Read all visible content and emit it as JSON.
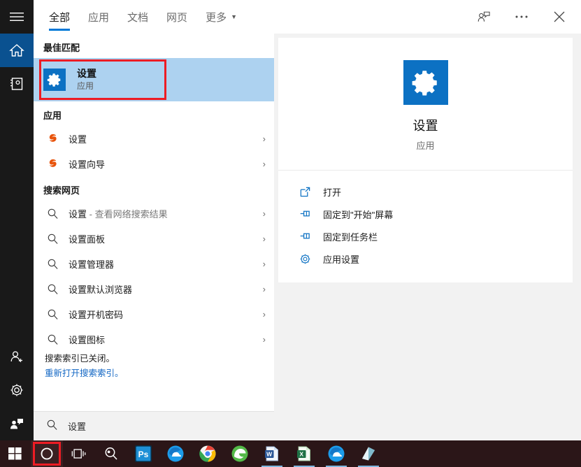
{
  "rail": {
    "items": [
      {
        "name": "hamburger",
        "label": "菜单"
      },
      {
        "name": "home",
        "label": "主页"
      },
      {
        "name": "notebook",
        "label": "笔记本"
      }
    ],
    "bottom_items": [
      {
        "name": "person-add",
        "label": "帐户"
      },
      {
        "name": "gear",
        "label": "设置"
      },
      {
        "name": "feedback",
        "label": "反馈"
      }
    ]
  },
  "tabs": [
    {
      "label": "全部",
      "active": true
    },
    {
      "label": "应用",
      "active": false
    },
    {
      "label": "文档",
      "active": false
    },
    {
      "label": "网页",
      "active": false
    },
    {
      "label": "更多",
      "active": false,
      "caret": "▼"
    }
  ],
  "best_match": {
    "heading": "最佳匹配",
    "title": "设置",
    "subtitle": "应用",
    "icon": "settings-gear-icon"
  },
  "apps_section": {
    "heading": "应用",
    "items": [
      {
        "label": "设置",
        "icon": "sogou-s-icon",
        "chevron": "›"
      },
      {
        "label": "设置向导",
        "icon": "sogou-s-icon",
        "chevron": "›"
      }
    ]
  },
  "web_section": {
    "heading": "搜索网页",
    "items": [
      {
        "label": "设置",
        "suffix": " - 查看网络搜索结果",
        "icon": "search-icon",
        "chevron": "›"
      },
      {
        "label": "设置面板",
        "suffix": "",
        "icon": "search-icon",
        "chevron": "›"
      },
      {
        "label": "设置管理器",
        "suffix": "",
        "icon": "search-icon",
        "chevron": "›"
      },
      {
        "label": "设置默认浏览器",
        "suffix": "",
        "icon": "search-icon",
        "chevron": "›"
      },
      {
        "label": "设置开机密码",
        "suffix": "",
        "icon": "search-icon",
        "chevron": "›"
      },
      {
        "label": "设置图标",
        "suffix": "",
        "icon": "search-icon",
        "chevron": "›"
      }
    ]
  },
  "notice": {
    "line1": "搜索索引已关闭。",
    "line2": "重新打开搜索索引。"
  },
  "searchbox": {
    "value": "设置",
    "icon": "search-icon"
  },
  "preview": {
    "titlebar_buttons": [
      {
        "name": "feedback-person-icon",
        "label": "反馈"
      },
      {
        "name": "more-ellipsis-icon",
        "label": "..."
      },
      {
        "name": "close-icon",
        "label": "✕"
      }
    ],
    "hero": {
      "title": "设置",
      "subtitle": "应用",
      "icon": "settings-gear-icon"
    },
    "actions": [
      {
        "label": "打开",
        "icon": "open-external-icon"
      },
      {
        "label": "固定到\"开始\"屏幕",
        "icon": "pin-icon"
      },
      {
        "label": "固定到任务栏",
        "icon": "pin-icon"
      },
      {
        "label": "应用设置",
        "icon": "gear-icon"
      }
    ]
  },
  "taskbar": {
    "start": {
      "name": "windows-start-icon"
    },
    "items": [
      {
        "name": "cortana-circle-icon",
        "highlighted": true,
        "running": false
      },
      {
        "name": "task-view-icon",
        "highlighted": false,
        "running": false
      },
      {
        "name": "search-magnifier-icon",
        "highlighted": false,
        "running": false
      },
      {
        "name": "photoshop-icon",
        "highlighted": false,
        "running": false
      },
      {
        "name": "cloud-blue-icon",
        "highlighted": false,
        "running": false
      },
      {
        "name": "chrome-icon",
        "highlighted": false,
        "running": false
      },
      {
        "name": "ie-edge-icon",
        "highlighted": false,
        "running": false
      },
      {
        "name": "word-icon",
        "highlighted": false,
        "running": true
      },
      {
        "name": "excel-icon",
        "highlighted": false,
        "running": true
      },
      {
        "name": "cloud-blue-2-icon",
        "highlighted": false,
        "running": true
      },
      {
        "name": "notebook-app-icon",
        "highlighted": false,
        "running": true
      }
    ]
  },
  "colors": {
    "accent": "#0078D7",
    "rail_active": "#0A5190",
    "highlight_row": "#ADD2F0",
    "annotation_red": "#ED1C24",
    "taskbar": "#2B1618"
  }
}
